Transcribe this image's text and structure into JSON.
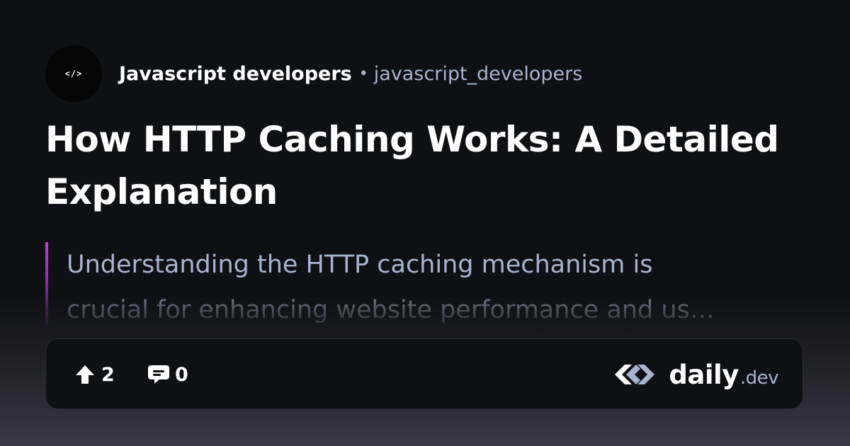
{
  "source": {
    "avatar_text": "</>",
    "name": "Javascript developers",
    "separator": "•",
    "handle": "javascript_developers"
  },
  "post": {
    "title": "How HTTP Caching Works: A Detailed Explanation",
    "summary_lines": [
      "Understanding the HTTP caching mechanism is",
      "crucial for enhancing website performance and us…"
    ]
  },
  "footer": {
    "upvotes": "2",
    "comments": "0",
    "upvote_icon": "arrow-up-icon",
    "comment_icon": "comment-icon"
  },
  "brand": {
    "logo_icon": "daily-dev-logo-icon",
    "word": "daily",
    "suffix": ".dev"
  },
  "colors": {
    "background": "#0e1013",
    "secondary_text": "#a8b3cf",
    "accent": "#b93ce0",
    "border": "#2c2d33"
  }
}
